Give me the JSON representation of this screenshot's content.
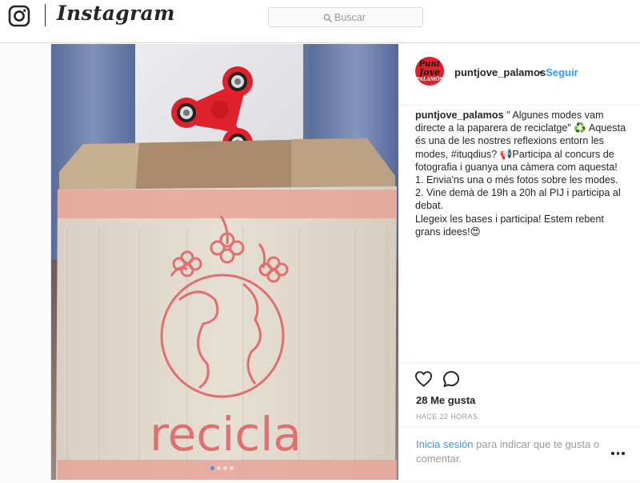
{
  "header": {
    "wordmark": "Instagram",
    "search": {
      "placeholder": "Buscar",
      "value": ""
    }
  },
  "post": {
    "author": {
      "username": "puntjove_palamos",
      "avatar_text": [
        "Punt",
        "Jove",
        "PALAMÓS"
      ]
    },
    "follow_separator": "•",
    "follow_label": "Seguir",
    "caption": {
      "username": "puntjove_palamos",
      "text": " \" Algunes modes vam directe a la paparera de reciclatge\" ♻️ Aquesta és una de les nostres reflexions entorn les modes, #ituqdius? 📢Participa al concurs de fotografia i guanya una càmera com aquesta!\n1. Envia'ns una o més fotos sobre les modes.\n2. Vine demà de 19h a 20h al PIJ i participa al debat.\nLlegeix les bases i participa! Estem rebent grans idees!😍"
    },
    "photo": {
      "box_text": "recicla",
      "carousel_dots": 4,
      "active_dot": 1
    },
    "likes": "28 Me gusta",
    "timestamp": "HACE 22 HORAS",
    "login_link": "Inicia sesión",
    "login_text": " para indicar que te gusta o comentar."
  },
  "icons": {
    "logo": "instagram-camera-icon",
    "search": "magnifier-icon",
    "like": "heart-outline-icon",
    "comment": "speech-bubble-icon",
    "more": "ellipsis-icon"
  },
  "colors": {
    "link_blue": "#3897f0",
    "border": "#dbdbdb",
    "spinner_red": "#e0202a",
    "box_print_red": "#e07070"
  }
}
